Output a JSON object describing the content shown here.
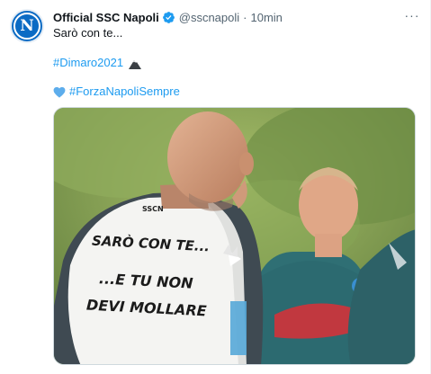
{
  "tweet": {
    "author_name": "Official SSC Napoli",
    "handle": "@sscnapoli",
    "separator": "·",
    "time": "10min",
    "avatar_letter": "N",
    "more_label": "···",
    "text_line1": "Sarò con te...",
    "hashtag1": "#Dimaro2021",
    "hashtag2": "#ForzaNapoliSempre"
  },
  "media": {
    "shirt_line1": "SARÒ CON TE...",
    "shirt_line2": "...E TU NON",
    "shirt_line3": "DEVI MOLLARE",
    "shirt_brand": "SSCN"
  },
  "colors": {
    "accent": "#1d9bf0",
    "verified": "#1d9bf0",
    "secondary_text": "#536471",
    "avatar": "#0b6bc4"
  }
}
